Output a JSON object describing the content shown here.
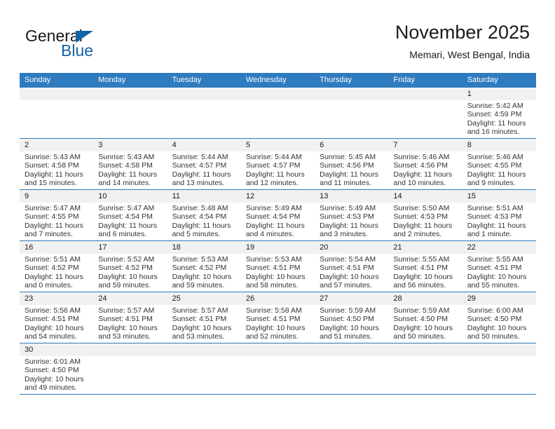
{
  "brand": {
    "name_part1": "General",
    "name_part2": "Blue",
    "accent_color": "#1464a5"
  },
  "header": {
    "month_title": "November 2025",
    "location": "Memari, West Bengal, India"
  },
  "calendar": {
    "header_color": "#2f7bbf",
    "weekdays": [
      "Sunday",
      "Monday",
      "Tuesday",
      "Wednesday",
      "Thursday",
      "Friday",
      "Saturday"
    ],
    "weeks": [
      [
        {
          "empty": true,
          "day": ""
        },
        {
          "empty": true,
          "day": ""
        },
        {
          "empty": true,
          "day": ""
        },
        {
          "empty": true,
          "day": ""
        },
        {
          "empty": true,
          "day": ""
        },
        {
          "empty": true,
          "day": ""
        },
        {
          "empty": false,
          "day": "1",
          "sunrise": "Sunrise: 5:42 AM",
          "sunset": "Sunset: 4:59 PM",
          "daylight": "Daylight: 11 hours and 16 minutes."
        }
      ],
      [
        {
          "empty": false,
          "day": "2",
          "sunrise": "Sunrise: 5:43 AM",
          "sunset": "Sunset: 4:58 PM",
          "daylight": "Daylight: 11 hours and 15 minutes."
        },
        {
          "empty": false,
          "day": "3",
          "sunrise": "Sunrise: 5:43 AM",
          "sunset": "Sunset: 4:58 PM",
          "daylight": "Daylight: 11 hours and 14 minutes."
        },
        {
          "empty": false,
          "day": "4",
          "sunrise": "Sunrise: 5:44 AM",
          "sunset": "Sunset: 4:57 PM",
          "daylight": "Daylight: 11 hours and 13 minutes."
        },
        {
          "empty": false,
          "day": "5",
          "sunrise": "Sunrise: 5:44 AM",
          "sunset": "Sunset: 4:57 PM",
          "daylight": "Daylight: 11 hours and 12 minutes."
        },
        {
          "empty": false,
          "day": "6",
          "sunrise": "Sunrise: 5:45 AM",
          "sunset": "Sunset: 4:56 PM",
          "daylight": "Daylight: 11 hours and 11 minutes."
        },
        {
          "empty": false,
          "day": "7",
          "sunrise": "Sunrise: 5:46 AM",
          "sunset": "Sunset: 4:56 PM",
          "daylight": "Daylight: 11 hours and 10 minutes."
        },
        {
          "empty": false,
          "day": "8",
          "sunrise": "Sunrise: 5:46 AM",
          "sunset": "Sunset: 4:55 PM",
          "daylight": "Daylight: 11 hours and 9 minutes."
        }
      ],
      [
        {
          "empty": false,
          "day": "9",
          "sunrise": "Sunrise: 5:47 AM",
          "sunset": "Sunset: 4:55 PM",
          "daylight": "Daylight: 11 hours and 7 minutes."
        },
        {
          "empty": false,
          "day": "10",
          "sunrise": "Sunrise: 5:47 AM",
          "sunset": "Sunset: 4:54 PM",
          "daylight": "Daylight: 11 hours and 6 minutes."
        },
        {
          "empty": false,
          "day": "11",
          "sunrise": "Sunrise: 5:48 AM",
          "sunset": "Sunset: 4:54 PM",
          "daylight": "Daylight: 11 hours and 5 minutes."
        },
        {
          "empty": false,
          "day": "12",
          "sunrise": "Sunrise: 5:49 AM",
          "sunset": "Sunset: 4:54 PM",
          "daylight": "Daylight: 11 hours and 4 minutes."
        },
        {
          "empty": false,
          "day": "13",
          "sunrise": "Sunrise: 5:49 AM",
          "sunset": "Sunset: 4:53 PM",
          "daylight": "Daylight: 11 hours and 3 minutes."
        },
        {
          "empty": false,
          "day": "14",
          "sunrise": "Sunrise: 5:50 AM",
          "sunset": "Sunset: 4:53 PM",
          "daylight": "Daylight: 11 hours and 2 minutes."
        },
        {
          "empty": false,
          "day": "15",
          "sunrise": "Sunrise: 5:51 AM",
          "sunset": "Sunset: 4:53 PM",
          "daylight": "Daylight: 11 hours and 1 minute."
        }
      ],
      [
        {
          "empty": false,
          "day": "16",
          "sunrise": "Sunrise: 5:51 AM",
          "sunset": "Sunset: 4:52 PM",
          "daylight": "Daylight: 11 hours and 0 minutes."
        },
        {
          "empty": false,
          "day": "17",
          "sunrise": "Sunrise: 5:52 AM",
          "sunset": "Sunset: 4:52 PM",
          "daylight": "Daylight: 10 hours and 59 minutes."
        },
        {
          "empty": false,
          "day": "18",
          "sunrise": "Sunrise: 5:53 AM",
          "sunset": "Sunset: 4:52 PM",
          "daylight": "Daylight: 10 hours and 59 minutes."
        },
        {
          "empty": false,
          "day": "19",
          "sunrise": "Sunrise: 5:53 AM",
          "sunset": "Sunset: 4:51 PM",
          "daylight": "Daylight: 10 hours and 58 minutes."
        },
        {
          "empty": false,
          "day": "20",
          "sunrise": "Sunrise: 5:54 AM",
          "sunset": "Sunset: 4:51 PM",
          "daylight": "Daylight: 10 hours and 57 minutes."
        },
        {
          "empty": false,
          "day": "21",
          "sunrise": "Sunrise: 5:55 AM",
          "sunset": "Sunset: 4:51 PM",
          "daylight": "Daylight: 10 hours and 56 minutes."
        },
        {
          "empty": false,
          "day": "22",
          "sunrise": "Sunrise: 5:55 AM",
          "sunset": "Sunset: 4:51 PM",
          "daylight": "Daylight: 10 hours and 55 minutes."
        }
      ],
      [
        {
          "empty": false,
          "day": "23",
          "sunrise": "Sunrise: 5:56 AM",
          "sunset": "Sunset: 4:51 PM",
          "daylight": "Daylight: 10 hours and 54 minutes."
        },
        {
          "empty": false,
          "day": "24",
          "sunrise": "Sunrise: 5:57 AM",
          "sunset": "Sunset: 4:51 PM",
          "daylight": "Daylight: 10 hours and 53 minutes."
        },
        {
          "empty": false,
          "day": "25",
          "sunrise": "Sunrise: 5:57 AM",
          "sunset": "Sunset: 4:51 PM",
          "daylight": "Daylight: 10 hours and 53 minutes."
        },
        {
          "empty": false,
          "day": "26",
          "sunrise": "Sunrise: 5:58 AM",
          "sunset": "Sunset: 4:51 PM",
          "daylight": "Daylight: 10 hours and 52 minutes."
        },
        {
          "empty": false,
          "day": "27",
          "sunrise": "Sunrise: 5:59 AM",
          "sunset": "Sunset: 4:50 PM",
          "daylight": "Daylight: 10 hours and 51 minutes."
        },
        {
          "empty": false,
          "day": "28",
          "sunrise": "Sunrise: 5:59 AM",
          "sunset": "Sunset: 4:50 PM",
          "daylight": "Daylight: 10 hours and 50 minutes."
        },
        {
          "empty": false,
          "day": "29",
          "sunrise": "Sunrise: 6:00 AM",
          "sunset": "Sunset: 4:50 PM",
          "daylight": "Daylight: 10 hours and 50 minutes."
        }
      ],
      [
        {
          "empty": false,
          "day": "30",
          "sunrise": "Sunrise: 6:01 AM",
          "sunset": "Sunset: 4:50 PM",
          "daylight": "Daylight: 10 hours and 49 minutes."
        },
        {
          "empty": true,
          "day": ""
        },
        {
          "empty": true,
          "day": ""
        },
        {
          "empty": true,
          "day": ""
        },
        {
          "empty": true,
          "day": ""
        },
        {
          "empty": true,
          "day": ""
        },
        {
          "empty": true,
          "day": ""
        }
      ]
    ]
  }
}
